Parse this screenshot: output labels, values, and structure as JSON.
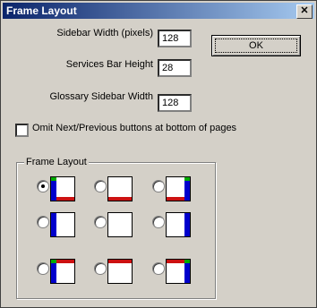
{
  "window": {
    "title": "Frame Layout",
    "close_glyph": "✕"
  },
  "fields": {
    "sidebar_width": {
      "label": "Sidebar Width (pixels)",
      "value": "128"
    },
    "services_bar_height": {
      "label": "Services Bar Height",
      "value": "28"
    },
    "glossary_sidebar_width": {
      "label": "Glossary Sidebar Width",
      "value": "128"
    }
  },
  "ok_button": {
    "label": "OK"
  },
  "omit_nav_checkbox": {
    "label": "Omit Next/Previous buttons at bottom of pages",
    "checked": false
  },
  "frame_layout_group": {
    "label": "Frame Layout",
    "selected_index": 0,
    "options_count": 9
  },
  "colors": {
    "sidebar": "#0000cc",
    "services_bar": "#cc1111",
    "glossary": "#0000cc",
    "corner": "#00aa00"
  }
}
